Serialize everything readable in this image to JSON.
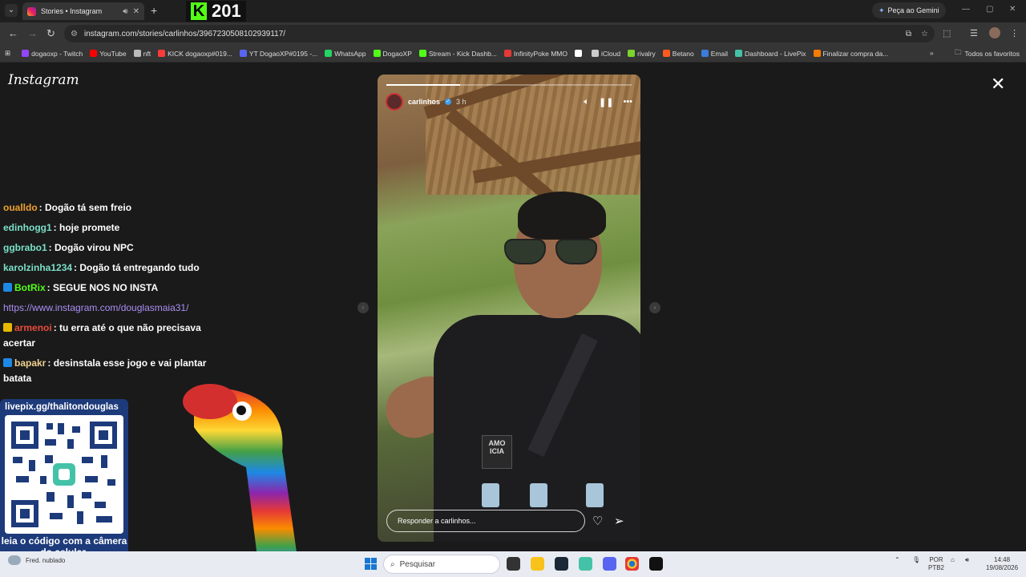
{
  "browser": {
    "tab": {
      "title": "Stories • Instagram"
    },
    "kick_overlay": {
      "letter": "K",
      "count": "201"
    },
    "gemini_button": "Peça ao Gemini",
    "url": "instagram.com/stories/carlinhos/3967230508102939117/"
  },
  "bookmarks": [
    {
      "label": "dogaoxp - Twitch",
      "color": "#9146ff"
    },
    {
      "label": "YouTube",
      "color": "#ff0000"
    },
    {
      "label": "nft",
      "color": "#bbbbbb"
    },
    {
      "label": "KICK dogaoxp#019...",
      "color": "#ff3a3a"
    },
    {
      "label": "YT DogaoXP#0195 -...",
      "color": "#5865f2"
    },
    {
      "label": "WhatsApp",
      "color": "#25d366"
    },
    {
      "label": "DogaoXP",
      "color": "#53fc18"
    },
    {
      "label": "Stream - Kick Dashb...",
      "color": "#53fc18"
    },
    {
      "label": "InfinityPoke MMO",
      "color": "#e53935"
    },
    {
      "label": "",
      "color": "#ffffff"
    },
    {
      "label": "iCloud",
      "color": "#cccccc"
    },
    {
      "label": "rivalry",
      "color": "#7cd32c"
    },
    {
      "label": "Betano",
      "color": "#ff5a1f"
    },
    {
      "label": "Email",
      "color": "#3d7bd9"
    },
    {
      "label": "Dashboard - LivePix",
      "color": "#44c2a8"
    },
    {
      "label": "Finalizar compra da...",
      "color": "#f57c00"
    }
  ],
  "bookmarks_all": "Todos os favoritos",
  "instagram": {
    "logo": "Instagram",
    "story": {
      "username": "carlinhos",
      "time": "3 h",
      "reply_placeholder": "Responder a carlinhos...",
      "progress": 0.3,
      "vest_patch": "AMO\nICIA"
    }
  },
  "chat": [
    {
      "name": "oualldo",
      "name_color": "#f0a030",
      "text": ": Dogão tá sem freio",
      "badge": null
    },
    {
      "name": "edinhogg1",
      "name_color": "#7be0c8",
      "text": ": hoje promete",
      "badge": null
    },
    {
      "name": "ggbrabo1",
      "name_color": "#7be0c8",
      "text": ": Dogão virou NPC",
      "badge": null
    },
    {
      "name": "karolzinha1234",
      "name_color": "#7be0c8",
      "text": ": Dogão tá entregando tudo",
      "badge": null
    },
    {
      "name": "BotRix",
      "name_color": "#53fc18",
      "text": ": SEGUE NOS NO INSTA",
      "badge": "#1e88e5"
    },
    {
      "name": "",
      "name_color": "#a98ff5",
      "text": "https://www.instagram.com/douglasmaia31/",
      "badge": null,
      "link": true
    },
    {
      "name": "armenoi",
      "name_color": "#e74c3c",
      "text": ": tu erra até o que não precisava acertar",
      "badge": "#e6b800"
    },
    {
      "name": "bapakr",
      "name_color": "#f0d090",
      "text": ": desinstala esse jogo e vai plantar batata",
      "badge": "#1e88e5"
    }
  ],
  "livepix": {
    "url": "livepix.gg/thalitondouglas",
    "caption": "leia o código com a câmera do celular."
  },
  "taskbar": {
    "weather": "Fred. nublado",
    "search_placeholder": "Pesquisar",
    "lang_top": "POR",
    "lang_bottom": "PTB2",
    "time": "14:48",
    "date": "19/08/2026"
  }
}
